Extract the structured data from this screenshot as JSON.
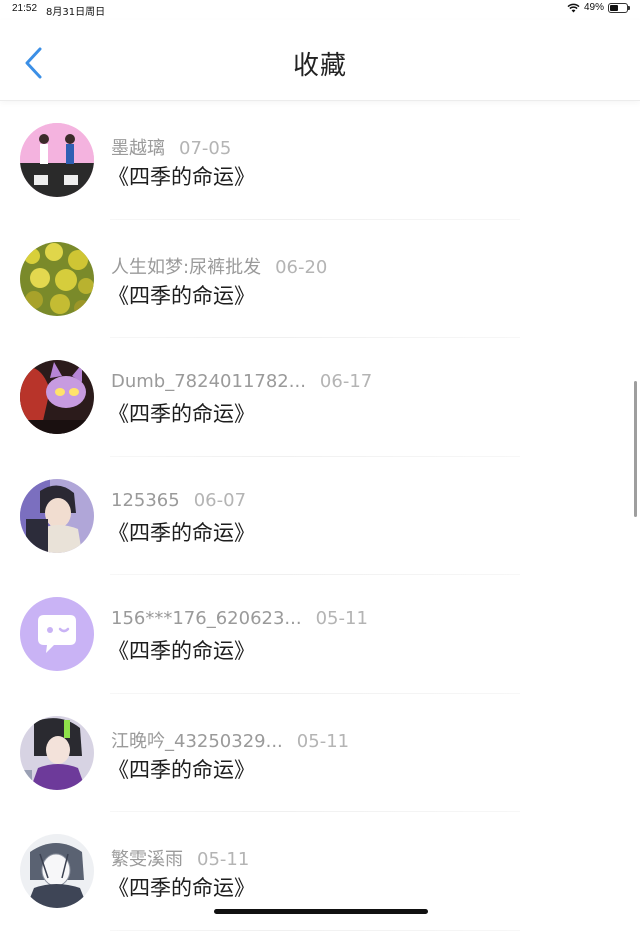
{
  "status_bar": {
    "time": "21:52",
    "date": "8月31日周日",
    "battery": "49%",
    "battery_level": 0.49
  },
  "header": {
    "title": "收藏"
  },
  "favorites": [
    {
      "user": "墨越璃",
      "date": "07-05",
      "title": "《四季的命运》",
      "avatar_style": "dancers"
    },
    {
      "user": "人生如梦:尿裤批发",
      "date": "06-20",
      "title": "《四季的命运》",
      "avatar_style": "flowers"
    },
    {
      "user": "Dumb_7824011782...",
      "date": "06-17",
      "title": "《四季的命运》",
      "avatar_style": "cartoon"
    },
    {
      "user": "125365",
      "date": "06-07",
      "title": "《四季的命运》",
      "avatar_style": "anime-boy"
    },
    {
      "user": "156***176_620623...",
      "date": "05-11",
      "title": "《四季的命运》",
      "avatar_style": "default-chat"
    },
    {
      "user": "江晚吟_43250329...",
      "date": "05-11",
      "title": "《四季的命运》",
      "avatar_style": "anime-purple"
    },
    {
      "user": "繁雯溪雨",
      "date": "05-11",
      "title": "《四季的命运》",
      "avatar_style": "sketch"
    }
  ],
  "colors": {
    "accent": "#3b8fe6",
    "default_avatar_bg": "#c9b3f5"
  }
}
